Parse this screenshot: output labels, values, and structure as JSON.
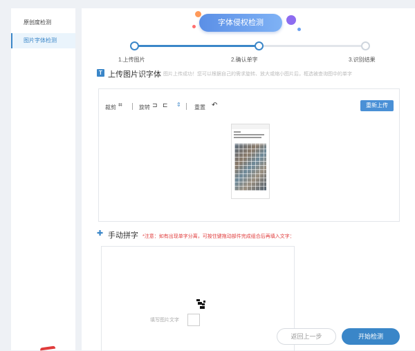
{
  "sidebar": {
    "items": [
      {
        "label": "原创度检测",
        "active": false
      },
      {
        "label": "图片字体检测",
        "active": true
      }
    ]
  },
  "banner": {
    "title": "字体侵权检测"
  },
  "steps": [
    {
      "label": "1.上传图片",
      "state": "done"
    },
    {
      "label": "2.确认单字",
      "state": "current"
    },
    {
      "label": "3.识别结果",
      "state": "todo"
    }
  ],
  "upload_section": {
    "icon": "T",
    "title": "上传图片识字体",
    "hint": "图片上传成功！您可以根据自己的需求旋转、放大或缩小图片后，框选被查询图中的单字"
  },
  "toolbar": {
    "crop_label": "裁剪",
    "rotate_label": "旋转",
    "reset_label": "重置",
    "reupload_label": "重新上传"
  },
  "manual_section": {
    "title": "手动拼字",
    "warning": "*注意：如有出现单字分离，可按住键拖动部件完成组合后再填入文字：",
    "fill_label": "填写图片文字"
  },
  "footer": {
    "back_label": "返回上一步",
    "start_label": "开始检测"
  },
  "colors": {
    "accent": "#3a86c8",
    "warning": "#e03c3c"
  }
}
